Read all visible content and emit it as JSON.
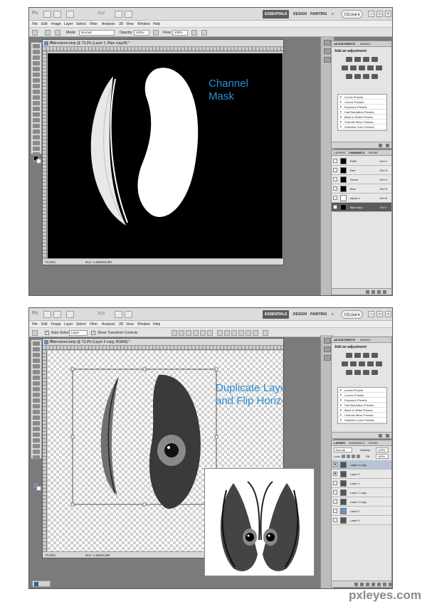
{
  "app": {
    "logo": "Ps",
    "zoom": "73,3",
    "workspaces": [
      "ESSENTIALS",
      "DESIGN",
      "PAINTING"
    ],
    "more": "»",
    "cs_live": "CS Live ▾",
    "window_controls": [
      "–",
      "□",
      "×"
    ]
  },
  "menu": [
    "File",
    "Edit",
    "Image",
    "Layer",
    "Select",
    "Filter",
    "Analysis",
    "3D",
    "View",
    "Window",
    "Help"
  ],
  "screen1": {
    "options": {
      "mode_label": "Mode:",
      "mode_value": "Normal",
      "opacity_label": "Opacity:",
      "opacity_value": "100%",
      "flow_label": "Flow:",
      "flow_value": "100%"
    },
    "document": {
      "title": "eldervsineo.bmp @ 73,3% (Layer 1, Blue copy/8) *",
      "zoom": "73,33%",
      "doc": "Doc: 2,46M/15,9M"
    },
    "annotation": "Channel\nMask",
    "adjustments": {
      "tabs": [
        "ADJUSTMENTS",
        "MASKS"
      ],
      "title": "Add an adjustment",
      "presets": [
        "Levels Presets",
        "Curves Presets",
        "Exposure Presets",
        "Hue/Saturation Presets",
        "Black & White Presets",
        "Channel Mixer Presets",
        "Selective Color Presets"
      ]
    },
    "channels": {
      "tabs": [
        "LAYERS",
        "CHANNELS",
        "PATHS"
      ],
      "rows": [
        {
          "name": "RGB",
          "key": "Ctrl+2"
        },
        {
          "name": "Red",
          "key": "Ctrl+3"
        },
        {
          "name": "Green",
          "key": "Ctrl+4"
        },
        {
          "name": "Blue",
          "key": "Ctrl+5"
        },
        {
          "name": "Alpha 1",
          "key": "Ctrl+6"
        },
        {
          "name": "Blue copy",
          "key": "Ctrl+7"
        }
      ]
    }
  },
  "screen2": {
    "options": {
      "auto_select": "Auto-Select:",
      "auto_select_value": "Layer",
      "transform": "Show Transform Controls"
    },
    "document": {
      "title": "eldervsineo.bmp @ 73,3% (Layer 3 copy, RGB/8) *",
      "zoom": "73,33%",
      "doc": "Doc: 2,46M/3,9M"
    },
    "annotation": "Duplicate Layer\nand Flip Horizontal",
    "adjustments": {
      "tabs": [
        "ADJUSTMENTS",
        "MASKS"
      ],
      "title": "Add an adjustment",
      "presets": [
        "Levels Presets",
        "Curves Presets",
        "Exposure Presets",
        "Hue/Saturation Presets",
        "Black & White Presets",
        "Channel Mixer Presets",
        "Selective Color Presets"
      ]
    },
    "layers": {
      "tabs": [
        "LAYERS",
        "CHANNELS",
        "PATHS"
      ],
      "blend": "Normal",
      "opacity_label": "Opacity:",
      "opacity_value": "100%",
      "lock_label": "Lock:",
      "fill_label": "Fill:",
      "fill_value": "100%",
      "rows": [
        "Layer 3 copy",
        "Layer 3",
        "Layer 1",
        "Layer 1 copy",
        "Layer 4 copy",
        "Layer 2",
        "Layer 4"
      ]
    }
  },
  "watermark": "pxleyes.com"
}
